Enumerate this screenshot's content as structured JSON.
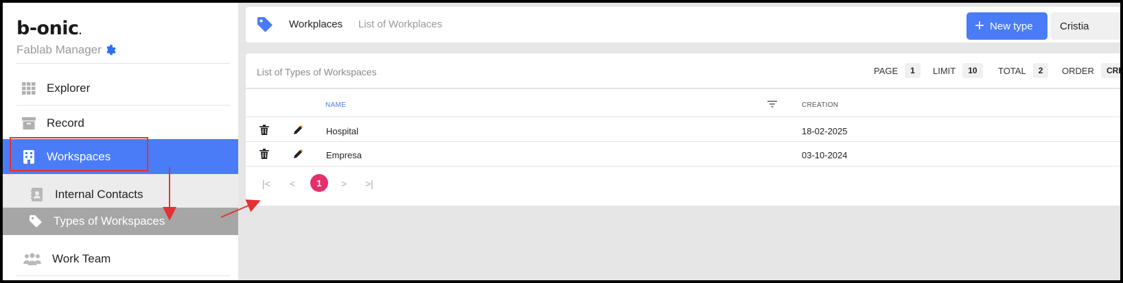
{
  "brand": {
    "logo": "b-onic",
    "subtitle": "Fablab Manager"
  },
  "sidebar": {
    "items": [
      {
        "label": "Explorer",
        "icon": "grid-icon"
      },
      {
        "label": "Record",
        "icon": "archive-icon"
      },
      {
        "label": "Workspaces",
        "icon": "building-icon",
        "active": true
      },
      {
        "label": "Internal Contacts",
        "icon": "contacts-icon"
      },
      {
        "label": "Types of Workspaces",
        "icon": "tag-icon",
        "selected": true
      },
      {
        "label": "Work Team",
        "icon": "users-icon"
      }
    ]
  },
  "topbar": {
    "breadcrumb_current": "Workplaces",
    "breadcrumb_sub": "List of Workplaces",
    "new_button": "New type",
    "user_button": "Cristia"
  },
  "list": {
    "title": "List of Types of Workspaces",
    "page_label": "PAGE",
    "page_value": "1",
    "limit_label": "LIMIT",
    "limit_value": "10",
    "total_label": "TOTAL",
    "total_value": "2",
    "order_label": "ORDER",
    "order_value": "CRE",
    "columns": {
      "name": "NAME",
      "creation": "CREATION"
    },
    "rows": [
      {
        "name": "Hospital",
        "creation": "18-02-2025"
      },
      {
        "name": "Empresa",
        "creation": "03-10-2024"
      }
    ],
    "pagination": {
      "current": "1",
      "first": "|<",
      "prev": "<",
      "next": ">",
      "last": ">|"
    }
  },
  "colors": {
    "accent": "#4a7cf7",
    "pager_active": "#e52e6a",
    "annotation": "#e23232"
  }
}
